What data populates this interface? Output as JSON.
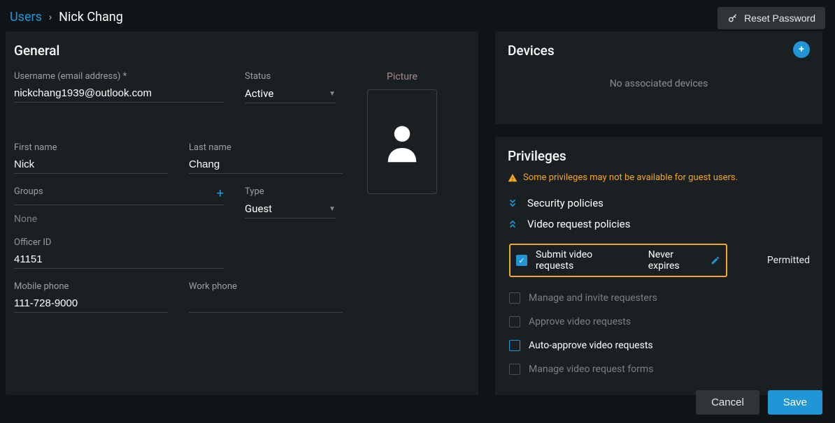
{
  "breadcrumb": {
    "link": "Users",
    "current": "Nick Chang"
  },
  "reset_password": "Reset Password",
  "general": {
    "title": "General",
    "username_label": "Username (email address) *",
    "username": "nickchang1939@outlook.com",
    "status_label": "Status",
    "status": "Active",
    "first_name_label": "First name",
    "first_name": "Nick",
    "last_name_label": "Last name",
    "last_name": "Chang",
    "type_label": "Type",
    "type": "Guest",
    "groups_label": "Groups",
    "groups_value": "None",
    "officer_id_label": "Officer ID",
    "officer_id": "41151",
    "mobile_label": "Mobile phone",
    "mobile": "111-728-9000",
    "work_label": "Work phone",
    "work": "",
    "picture_label": "Picture"
  },
  "devices": {
    "title": "Devices",
    "empty": "No associated devices"
  },
  "privileges": {
    "title": "Privileges",
    "warning": "Some privileges may not be available for guest users.",
    "security_policies": "Security policies",
    "video_request_policies": "Video request policies",
    "submit_label": "Submit video requests",
    "never_expires": "Never expires",
    "permitted": "Permitted",
    "manage_invite": "Manage and invite requesters",
    "approve": "Approve video requests",
    "auto_approve": "Auto-approve video requests",
    "manage_forms": "Manage video request forms"
  },
  "footer": {
    "cancel": "Cancel",
    "save": "Save"
  }
}
